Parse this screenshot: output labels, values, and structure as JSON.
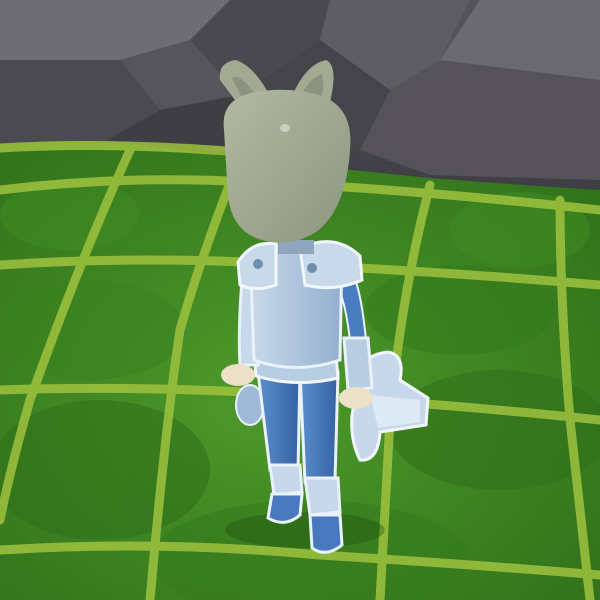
{
  "scene": {
    "description_free": true,
    "colors": {
      "rock_dark": "#3b3a40",
      "rock_mid": "#58565e",
      "rock_light": "#75737a",
      "grass_dark": "#3f7f22",
      "grass_mid": "#4f9a2c",
      "grid_line": "#9fc23e",
      "helmet": "#a5ad94",
      "helmet_shadow": "#868e78",
      "armor_light": "#b9cde0",
      "armor_mid": "#8eaed0",
      "armor_blue": "#4c7fc0",
      "armor_dark": "#3566a8",
      "hand": "#e8dcc4",
      "outline": "#e9f2fb"
    }
  }
}
